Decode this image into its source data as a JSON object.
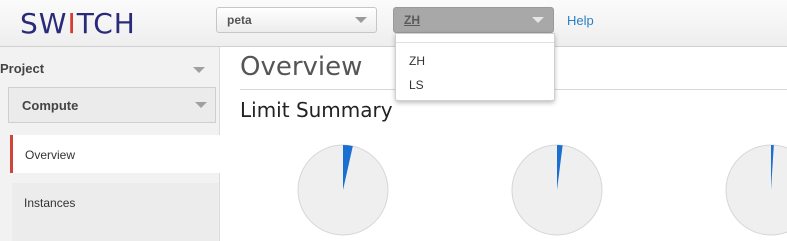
{
  "brand": {
    "logo_prefix": "SW",
    "logo_accent": "I",
    "logo_suffix": "TCH"
  },
  "header": {
    "tenant_select": {
      "value": "peta"
    },
    "region_select": {
      "value": "ZH",
      "options": [
        "ZH",
        "LS"
      ]
    },
    "help_label": "Help"
  },
  "sidebar": {
    "project_label": "Project",
    "compute_label": "Compute",
    "items": [
      {
        "label": "Overview",
        "active": true
      },
      {
        "label": "Instances",
        "active": false
      }
    ]
  },
  "main": {
    "title": "Overview",
    "section_title": "Limit Summary"
  },
  "chart_data": {
    "type": "pie",
    "title": "Limit Summary",
    "charts": [
      {
        "used_fraction": 0.035
      },
      {
        "used_fraction": 0.02
      },
      {
        "used_fraction": 0.01
      }
    ],
    "used_color": "#1a6fd1",
    "free_color": "#efefef"
  }
}
